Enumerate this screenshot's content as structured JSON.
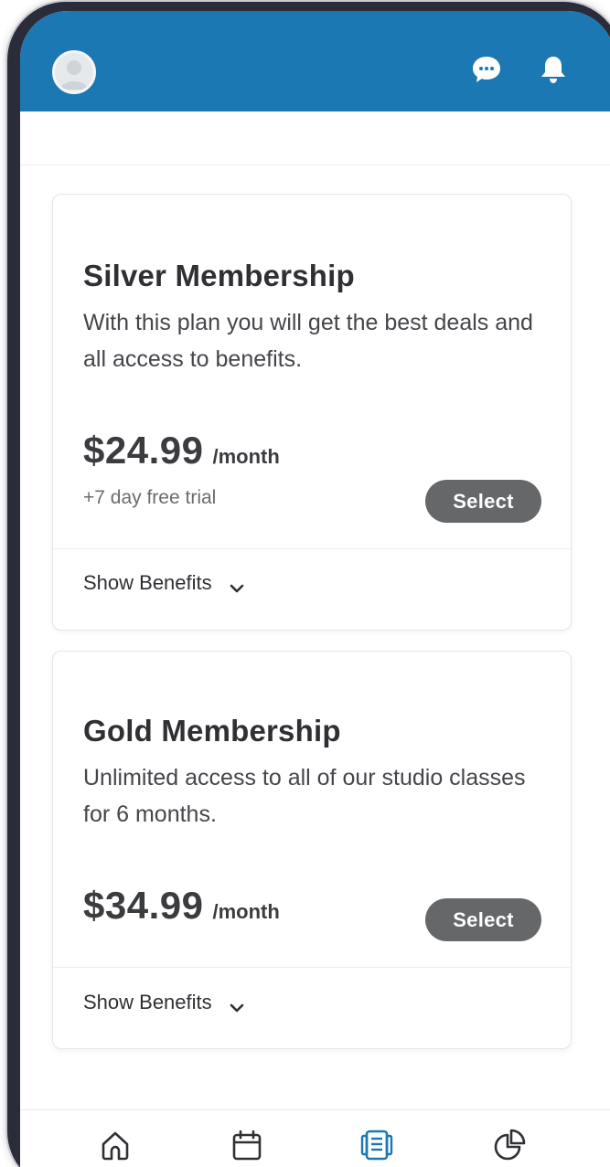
{
  "header": {
    "avatar": "user-avatar",
    "icons": [
      "chat-icon",
      "bell-icon"
    ]
  },
  "plans": [
    {
      "title": "Silver Membership",
      "description": "With this plan you will get the best deals and all access to benefits.",
      "price": "$24.99",
      "period": "/month",
      "trial": "+7 day free trial",
      "select_label": "Select",
      "benefits_label": "Show Benefits"
    },
    {
      "title": "Gold Membership",
      "description": "Unlimited access to all of our studio classes for 6 months.",
      "price": "$34.99",
      "period": "/month",
      "select_label": "Select",
      "benefits_label": "Show Benefits"
    }
  ],
  "bottom_nav": {
    "items": [
      {
        "icon": "home-icon",
        "active": false
      },
      {
        "icon": "calendar-icon",
        "active": false
      },
      {
        "icon": "plans-icon",
        "active": true
      },
      {
        "icon": "pie-chart-icon",
        "active": false
      }
    ]
  },
  "colors": {
    "header_bg": "#1c78b2",
    "active_nav": "#1c78b2",
    "button_bg": "#666769"
  }
}
